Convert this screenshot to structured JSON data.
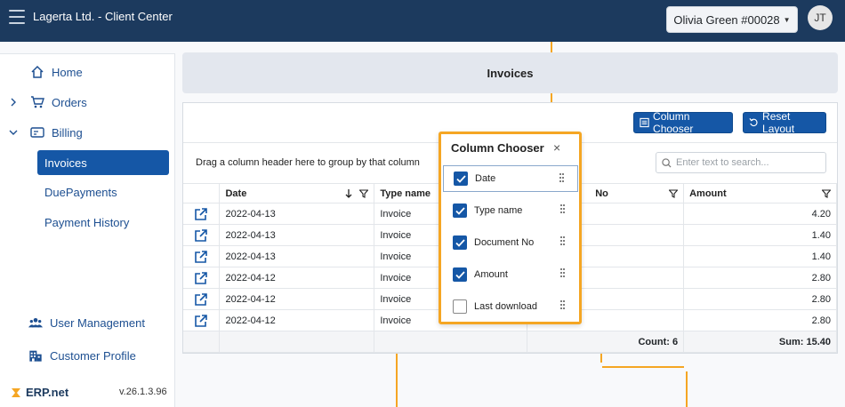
{
  "header": {
    "app_title": "Lagerta Ltd. - Client Center",
    "user_label": "Olivia Green #00028",
    "avatar_initials": "JT"
  },
  "sidebar": {
    "home": "Home",
    "orders": "Orders",
    "billing": "Billing",
    "billing_items": [
      "Invoices",
      "DuePayments",
      "Payment History"
    ],
    "user_management": "User Management",
    "customer_profile": "Customer Profile",
    "brand": "ERP.net",
    "version": "v.26.1.3.96"
  },
  "page": {
    "title": "Invoices"
  },
  "toolbar": {
    "column_chooser": "Column Chooser",
    "reset_layout": "Reset Layout",
    "group_hint": "Drag a column header here to group by that column",
    "search_placeholder": "Enter text to search..."
  },
  "grid": {
    "columns": {
      "date": "Date",
      "type_name": "Type name",
      "document_no": "No",
      "amount": "Amount"
    },
    "rows": [
      {
        "date": "2022-04-13",
        "type": "Invoice",
        "amount": "4.20"
      },
      {
        "date": "2022-04-13",
        "type": "Invoice",
        "amount": "1.40"
      },
      {
        "date": "2022-04-13",
        "type": "Invoice",
        "amount": "1.40"
      },
      {
        "date": "2022-04-12",
        "type": "Invoice",
        "amount": "2.80"
      },
      {
        "date": "2022-04-12",
        "type": "Invoice",
        "amount": "2.80"
      },
      {
        "date": "2022-04-12",
        "type": "Invoice",
        "amount": "2.80"
      }
    ],
    "count_label": "Count: 6",
    "sum_label": "Sum: 15.40"
  },
  "column_chooser": {
    "title": "Column Chooser",
    "close": "×",
    "items": [
      {
        "label": "Date",
        "checked": true
      },
      {
        "label": "Type name",
        "checked": true
      },
      {
        "label": "Document No",
        "checked": true
      },
      {
        "label": "Amount",
        "checked": true
      },
      {
        "label": "Last download",
        "checked": false
      }
    ]
  },
  "colors": {
    "topbar": "#1c3a5e",
    "accent": "#1557a6",
    "highlight": "#f5a623"
  }
}
